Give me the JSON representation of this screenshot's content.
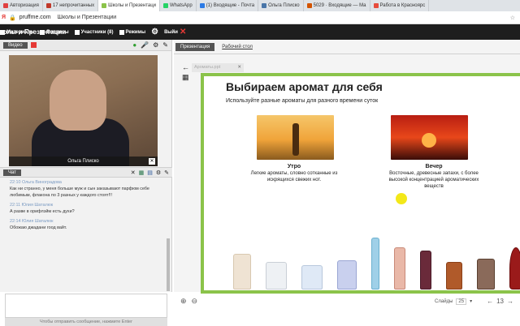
{
  "browser": {
    "tabs": [
      {
        "label": "Авторизация",
        "color": "#e04040"
      },
      {
        "label": "17 непрочитанных",
        "color": "#c0392b"
      },
      {
        "label": "Школы и Презентаци",
        "color": "#8bc34a"
      },
      {
        "label": "WhatsApp",
        "color": "#25d366"
      },
      {
        "label": "(1) Входящие - Почта",
        "color": "#2c7be5"
      },
      {
        "label": "Ольга Плиско",
        "color": "#4a76a8"
      },
      {
        "label": "5029 · Входящие — Ма",
        "color": "#d35400"
      },
      {
        "label": "Работа в Красноярс",
        "color": "#e74c3c"
      }
    ],
    "url": "pruffme.com",
    "page_title": "Школы и Презентации"
  },
  "app": {
    "title": "колы и Презентации",
    "nav": {
      "materials": "Материалы",
      "questions": "Вопросы",
      "participants": "Участники (8)",
      "modes": "Режимы",
      "exit": "Выйи"
    }
  },
  "video": {
    "label": "Видео",
    "speaker_name": "Ольга Плиско"
  },
  "chat": {
    "label": "Чат",
    "messages": [
      {
        "meta": "22:10 Ольга Виноградова",
        "text": "Как ни странно, у меня больше муж и сын заказывают парфюм себе любимым, флакона по 3 разных у каждого стоят!!!"
      },
      {
        "meta": "22:11 Юлия Шаталюк",
        "text": "А разве в орифлэйм есть духи?"
      },
      {
        "meta": "22:14 Юлия Шаталюк",
        "text": "Обожаю джадани гоод вайт."
      }
    ],
    "send_hint": "Чтобы отправить сообщение, нажмите Enter"
  },
  "presentation": {
    "tabs": {
      "active": "Презентация",
      "other": "Рабочий стол"
    },
    "file": "Ароматы.ppt",
    "slide": {
      "title": "Выбираем аромат для себя",
      "subtitle": "Используйте разные ароматы для разного времени суток",
      "morning_title": "Утро",
      "morning_text": "Легкие ароматы, словно сотканные из искрящихся свежих нот.",
      "evening_title": "Вечер",
      "evening_text": "Восточные, древесные запахи, с более высокой концентрацией ароматических веществ"
    },
    "pager": {
      "label": "Слайды",
      "total": "25",
      "current": "13"
    }
  },
  "colors": {
    "accent": "#8bc34a",
    "record": "#e53935",
    "appbar": "#1e1e1e"
  }
}
